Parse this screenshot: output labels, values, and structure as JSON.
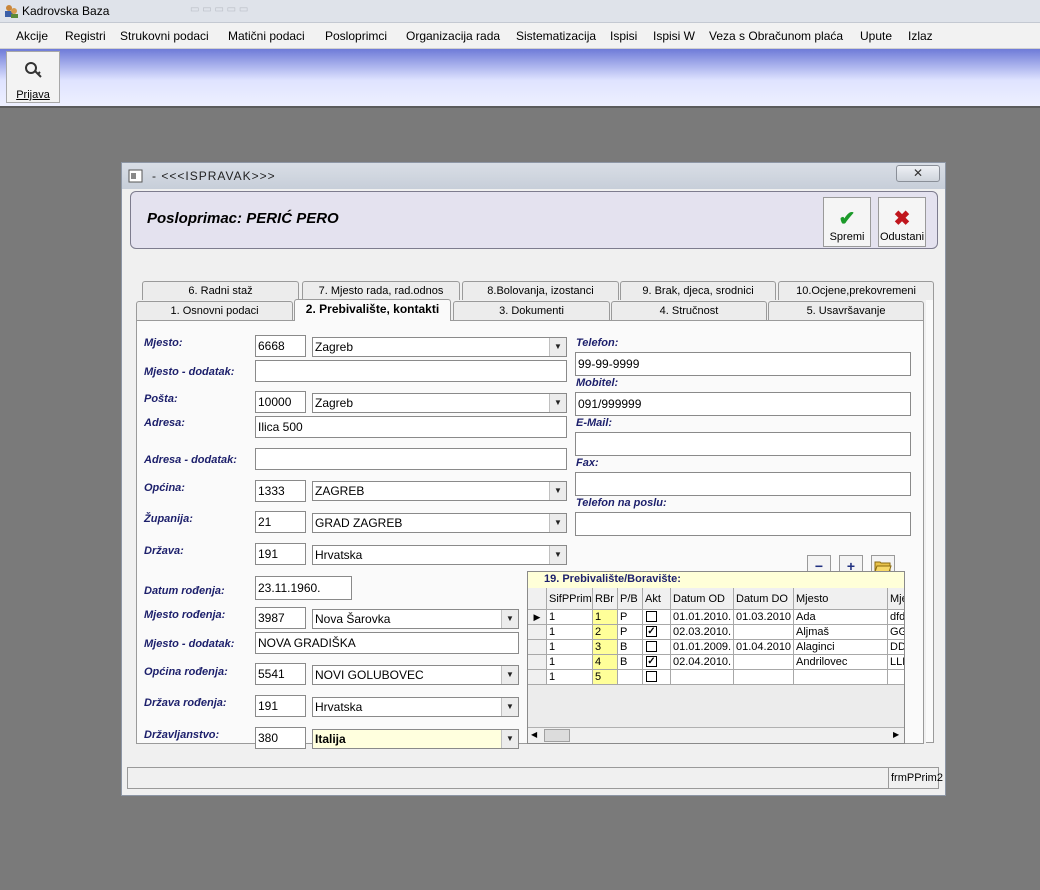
{
  "app": {
    "title": "Kadrovska Baza"
  },
  "menu": [
    "Akcije",
    "Registri",
    "Strukovni podaci",
    "Matični podaci",
    "Posloprimci",
    "Organizacija rada",
    "Sistematizacija",
    "Ispisi",
    "Ispisi W",
    "Veza s Obračunom plaća",
    "Upute",
    "Izlaz"
  ],
  "toolbar": {
    "login_label": "Prijava"
  },
  "dialog": {
    "title": "-  <<<ISPRAVAK>>>",
    "close_glyph": "✕",
    "header": "Posloprimac:  PERIĆ PERO",
    "save_label": "Spremi",
    "cancel_label": "Odustani",
    "status_text": "frmPPrim2"
  },
  "tabs_back": [
    "6. Radni staž",
    "7. Mjesto rada, rad.odnos",
    "8.Bolovanja, izostanci",
    "9. Brak, djeca, srodnici",
    "10.Ocjene,prekovremeni"
  ],
  "tabs_front": [
    "1. Osnovni podaci",
    "2. Prebivalište, kontakti",
    "3. Dokumenti",
    "4. Stručnost",
    "5. Usavršavanje"
  ],
  "form": {
    "mjesto": {
      "label": "Mjesto:",
      "code": "6668",
      "value": "Zagreb"
    },
    "mjesto_dodatak": {
      "label": "Mjesto - dodatak:",
      "value": ""
    },
    "posta": {
      "label": "Pošta:",
      "code": "10000",
      "value": "Zagreb"
    },
    "adresa": {
      "label": "Adresa:",
      "value": "Ilica 500"
    },
    "adresa_dodatak": {
      "label": "Adresa - dodatak:",
      "value": ""
    },
    "opcina": {
      "label": "Općina:",
      "code": "1333",
      "value": "ZAGREB"
    },
    "zupanija": {
      "label": "Županija:",
      "code": "21",
      "value": "GRAD ZAGREB"
    },
    "drzava": {
      "label": "Država:",
      "code": "191",
      "value": "Hrvatska"
    },
    "datum_rodjenja": {
      "label": "Datum rođenja:",
      "value": "23.11.1960."
    },
    "mjesto_rodjenja": {
      "label": "Mjesto rođenja:",
      "code": "3987",
      "value": "Nova Šarovka"
    },
    "mjesto_rod_dodatak": {
      "label": "Mjesto - dodatak:",
      "value": "NOVA GRADIŠKA"
    },
    "opcina_rodjenja": {
      "label": "Općina rođenja:",
      "code": "5541",
      "value": "NOVI GOLUBOVEC"
    },
    "drzava_rodjenja": {
      "label": "Država rođenja:",
      "code": "191",
      "value": "Hrvatska"
    },
    "drzavljanstvo": {
      "label": "Državljanstvo:",
      "code": "380",
      "value": "Italija"
    },
    "telefon": {
      "label": "Telefon:",
      "value": "99-99-9999"
    },
    "mobitel": {
      "label": "Mobitel:",
      "value": "091/999999"
    },
    "email": {
      "label": "E-Mail:",
      "value": ""
    },
    "fax": {
      "label": "Fax:",
      "value": ""
    },
    "telefon_posao": {
      "label": "Telefon na poslu:",
      "value": ""
    }
  },
  "grid": {
    "title": "19. Prebivalište/Boravište:",
    "minus": "−",
    "plus": "+",
    "columns": [
      "SifPPrim",
      "RBr",
      "P/B",
      "Akt",
      "Datum OD",
      "Datum DO",
      "Mjesto",
      "Mje"
    ],
    "rows": [
      {
        "sif": "1",
        "rbr": "1",
        "pb": "P",
        "akt": false,
        "od": "01.01.2010.",
        "do": "01.03.2010",
        "mjesto": "Ada",
        "mje2": "dfd"
      },
      {
        "sif": "1",
        "rbr": "2",
        "pb": "P",
        "akt": true,
        "od": "02.03.2010.",
        "do": "",
        "mjesto": "Aljmaš",
        "mje2": "GG"
      },
      {
        "sif": "1",
        "rbr": "3",
        "pb": "B",
        "akt": false,
        "od": "01.01.2009.",
        "do": "01.04.2010",
        "mjesto": "Alaginci",
        "mje2": "DD"
      },
      {
        "sif": "1",
        "rbr": "4",
        "pb": "B",
        "akt": true,
        "od": "02.04.2010.",
        "do": "",
        "mjesto": "Andrilovec",
        "mje2": "LLL"
      },
      {
        "sif": "1",
        "rbr": "5",
        "pb": "",
        "akt": false,
        "od": "",
        "do": "",
        "mjesto": "",
        "mje2": ""
      }
    ]
  }
}
